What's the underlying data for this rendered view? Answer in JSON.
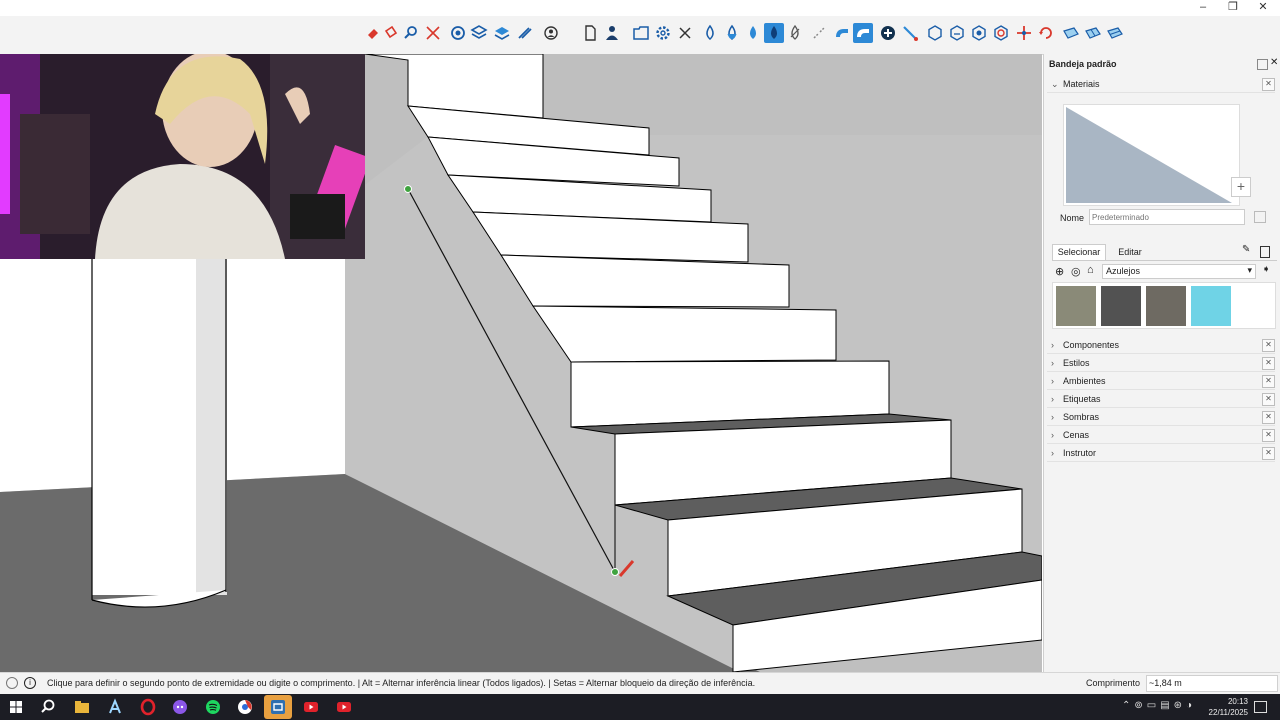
{
  "window": {
    "minimize": "–",
    "restore": "❐",
    "close": "✕"
  },
  "toolbar": {
    "icons": [
      "eraser-icon",
      "paint-bucket-icon",
      "zoom-icon",
      "zoom-extents-icon",
      "orbit-icon",
      "section-plane-icon",
      "layers-icon",
      "style-icon",
      "user-icon",
      "page-icon",
      "person-icon",
      "box-select-icon",
      "settings-icon",
      "cross-icon",
      "drop-icon",
      "drop-half-icon",
      "drop-icon",
      "drop-filled-icon",
      "leaf-icon",
      "magnet-icon",
      "magnet-icon",
      "magnet-active-icon",
      "add-icon",
      "pen-icon",
      "cube-icon",
      "cube-icon",
      "cube-icon",
      "cube-icon",
      "move-icon",
      "rotate-icon",
      "tile-icon",
      "tile-icon",
      "tile-icon"
    ]
  },
  "tray": {
    "title": "Bandeja padrão",
    "materials": {
      "header": "Materiais",
      "name_label": "Nome",
      "name_placeholder": "Predeterminado",
      "tabs": [
        "Selecionar",
        "Editar"
      ],
      "library": "Azulejos",
      "swatch_colors": [
        "#8a8a78",
        "#525252",
        "#6e6a62",
        "#6fd3e6"
      ]
    },
    "sections": [
      "Componentes",
      "Estilos",
      "Ambientes",
      "Etiquetas",
      "Sombras",
      "Cenas",
      "Instrutor"
    ]
  },
  "status": {
    "hint": "Clique para definir o segundo ponto de extremidade ou digite o comprimento. | Alt = Alternar inferência linear (Todos ligados). | Setas = Alternar bloqueio da direção de inferência.",
    "measure_label": "Comprimento",
    "measure_value": "~1,84 m"
  },
  "taskbar": {
    "time": "20:13",
    "date": "22/11/2025",
    "apps": [
      "start-icon",
      "search-icon",
      "files-icon",
      "app-a-icon",
      "opera-icon",
      "discord-icon",
      "spotify-icon",
      "chrome-icon",
      "sketchup-icon",
      "youtube-icon",
      "youtube-icon"
    ]
  },
  "colors": {
    "accent": "#2d89d6",
    "floor": "#6b6b6b",
    "wall": "#bfbfbf",
    "inference_point": "#3fa33f"
  }
}
